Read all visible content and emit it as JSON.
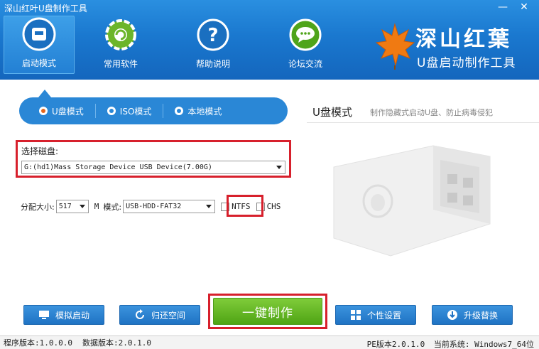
{
  "window": {
    "title": "深山红叶U盘制作工具",
    "minimize_glyph": "—",
    "close_glyph": "✕"
  },
  "nav": [
    {
      "label": "启动模式",
      "icon": "usb-drive-icon",
      "active": true
    },
    {
      "label": "常用软件",
      "icon": "software-gear-icon",
      "active": false
    },
    {
      "label": "帮助说明",
      "icon": "help-question-icon",
      "active": false
    },
    {
      "label": "论坛交流",
      "icon": "chat-bubble-icon",
      "active": false
    }
  ],
  "logo": {
    "title": "深山红葉",
    "subtitle": "U盘启动制作工具"
  },
  "modes": [
    {
      "label": "U盘模式",
      "selected": true
    },
    {
      "label": "ISO模式",
      "selected": false
    },
    {
      "label": "本地模式",
      "selected": false
    }
  ],
  "mode_info": {
    "title": "U盘模式",
    "description": "制作隐藏式启动U盘、防止病毒侵犯"
  },
  "disk": {
    "label": "选择磁盘:",
    "value": "G:(hd1)Mass Storage Device USB Device(7.00G)"
  },
  "partition": {
    "size_label": "分配大小:",
    "size_value": "517",
    "unit": "M",
    "mode_label": "模式:",
    "mode_value": "USB-HDD-FAT32",
    "ntfs_label": "NTFS",
    "chs_label": "CHS"
  },
  "buttons": {
    "simulate": "模拟启动",
    "restore": "归还空间",
    "make": "一键制作",
    "personalize": "个性设置",
    "upgrade": "升级替换"
  },
  "status": {
    "program_version": "程序版本:1.0.0.0",
    "data_version": "数据版本:2.0.1.0",
    "pe_version": "PE版本2.0.1.0",
    "system": "当前系统: Windows7_64位"
  },
  "colors": {
    "accent_blue": "#1a78cf",
    "highlight_red": "#d7202c",
    "make_green": "#5fb31f",
    "radio_orange": "#e8661a"
  }
}
